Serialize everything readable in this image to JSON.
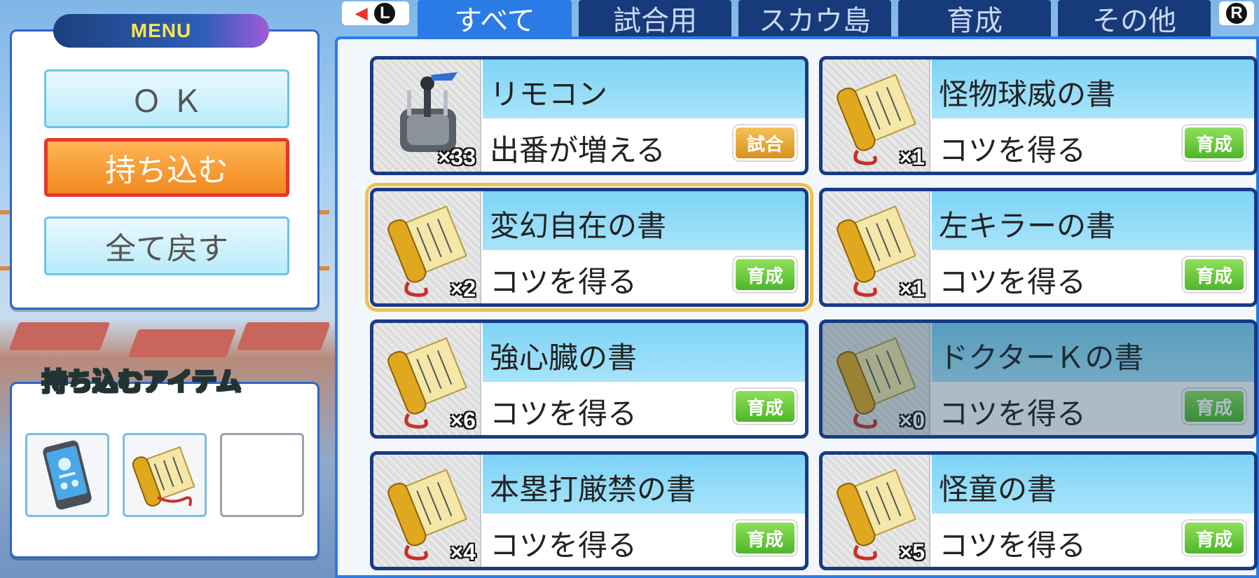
{
  "menu": {
    "title": "MENU",
    "buttons": [
      {
        "label": "Ｏ Ｋ"
      },
      {
        "label": "持ち込む"
      },
      {
        "label": "全て戻す"
      }
    ]
  },
  "carry": {
    "title": "持ち込むアイテム",
    "slots": [
      "phone-item-icon",
      "scroll-item-icon",
      "empty"
    ]
  },
  "tabs": {
    "left_key": "L",
    "right_key": "R",
    "items": [
      {
        "label": "すべて"
      },
      {
        "label": "試合用"
      },
      {
        "label": "スカウ島"
      },
      {
        "label": "育成"
      },
      {
        "label": "その他"
      }
    ]
  },
  "items": [
    {
      "name": "リモコン",
      "effect": "出番が増える",
      "category": "試合",
      "count": "×33",
      "icon": "remote-control-icon"
    },
    {
      "name": "怪物球威の書",
      "effect": "コツを得る",
      "category": "育成",
      "count": "×1",
      "icon": "scroll-icon"
    },
    {
      "name": "変幻自在の書",
      "effect": "コツを得る",
      "category": "育成",
      "count": "×2",
      "icon": "scroll-icon"
    },
    {
      "name": "左キラーの書",
      "effect": "コツを得る",
      "category": "育成",
      "count": "×1",
      "icon": "scroll-icon"
    },
    {
      "name": "強心臓の書",
      "effect": "コツを得る",
      "category": "育成",
      "count": "×6",
      "icon": "scroll-icon"
    },
    {
      "name": "ドクターＫの書",
      "effect": "コツを得る",
      "category": "育成",
      "count": "×0",
      "icon": "scroll-icon"
    },
    {
      "name": "本塁打厳禁の書",
      "effect": "コツを得る",
      "category": "育成",
      "count": "×4",
      "icon": "scroll-icon"
    },
    {
      "name": "怪童の書",
      "effect": "コツを得る",
      "category": "育成",
      "count": "×5",
      "icon": "scroll-icon"
    }
  ],
  "colors": {
    "panel_border": "#2a7be5",
    "tab_active": "#2a7be5",
    "tab_inactive": "#173a7a",
    "card_name_band": "#7dd3f5",
    "selected_outline": "#f2c14b",
    "category_train": "#4fb62a",
    "category_game": "#d8921f"
  }
}
